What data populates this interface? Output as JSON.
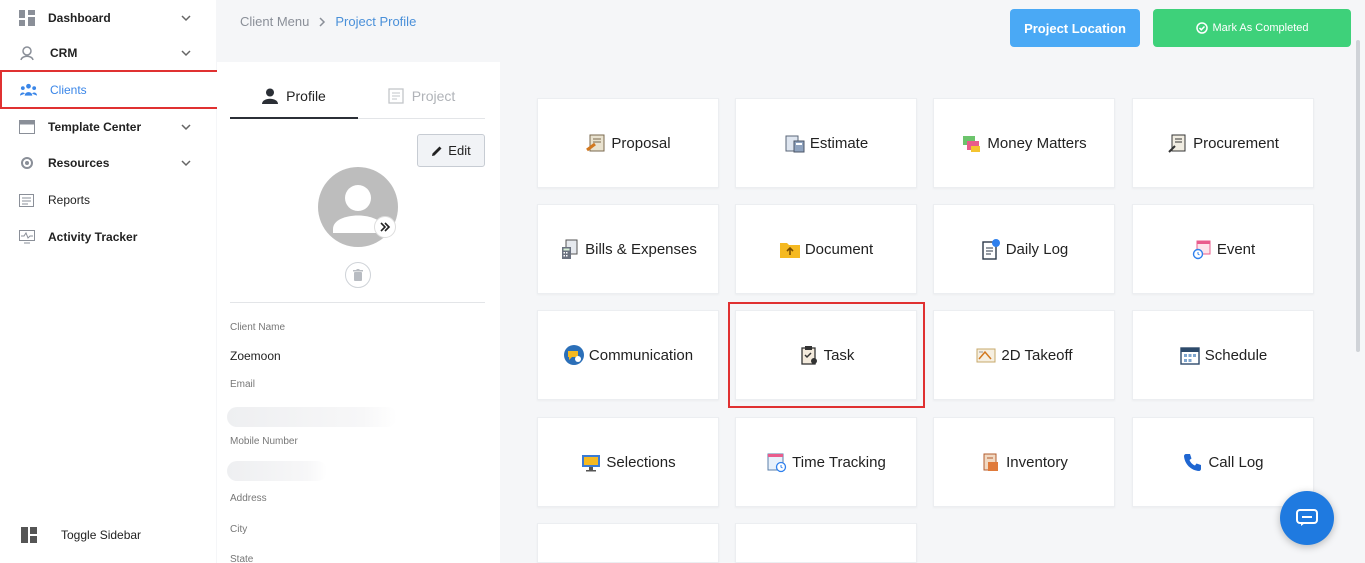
{
  "sidebar": {
    "items": [
      {
        "label": "Dashboard"
      },
      {
        "label": "CRM"
      },
      {
        "label": "Clients"
      },
      {
        "label": "Template Center"
      },
      {
        "label": "Resources"
      },
      {
        "label": "Reports"
      },
      {
        "label": "Activity Tracker"
      }
    ],
    "toggle_label": "Toggle Sidebar"
  },
  "breadcrumb": {
    "parent": "Client Menu",
    "current": "Project Profile"
  },
  "actions": {
    "location": "Project Location",
    "complete": "Mark As Completed"
  },
  "profile": {
    "tabs": {
      "profile": "Profile",
      "project": "Project"
    },
    "edit_label": "Edit",
    "fields": {
      "client_name_label": "Client Name",
      "client_name": "Zoemoon",
      "email_label": "Email",
      "mobile_label": "Mobile Number",
      "address_label": "Address",
      "city_label": "City",
      "state_label": "State"
    }
  },
  "modules": [
    {
      "label": "Proposal",
      "icon": "proposal-icon"
    },
    {
      "label": "Estimate",
      "icon": "estimate-icon"
    },
    {
      "label": "Money Matters",
      "icon": "money-icon"
    },
    {
      "label": "Procurement",
      "icon": "procurement-icon"
    },
    {
      "label": "Bills & Expenses",
      "icon": "bills-icon"
    },
    {
      "label": "Document",
      "icon": "document-icon"
    },
    {
      "label": "Daily Log",
      "icon": "daily-log-icon"
    },
    {
      "label": "Event",
      "icon": "event-icon"
    },
    {
      "label": "Communication",
      "icon": "communication-icon"
    },
    {
      "label": "Task",
      "icon": "task-icon"
    },
    {
      "label": "2D Takeoff",
      "icon": "takeoff-icon"
    },
    {
      "label": "Schedule",
      "icon": "schedule-icon"
    },
    {
      "label": "Selections",
      "icon": "selections-icon"
    },
    {
      "label": "Time Tracking",
      "icon": "time-tracking-icon"
    },
    {
      "label": "Inventory",
      "icon": "inventory-icon"
    },
    {
      "label": "Call Log",
      "icon": "call-log-icon"
    }
  ],
  "colors": {
    "accent": "#4aa9f5",
    "success": "#3ed17a",
    "highlight": "#e03131"
  }
}
